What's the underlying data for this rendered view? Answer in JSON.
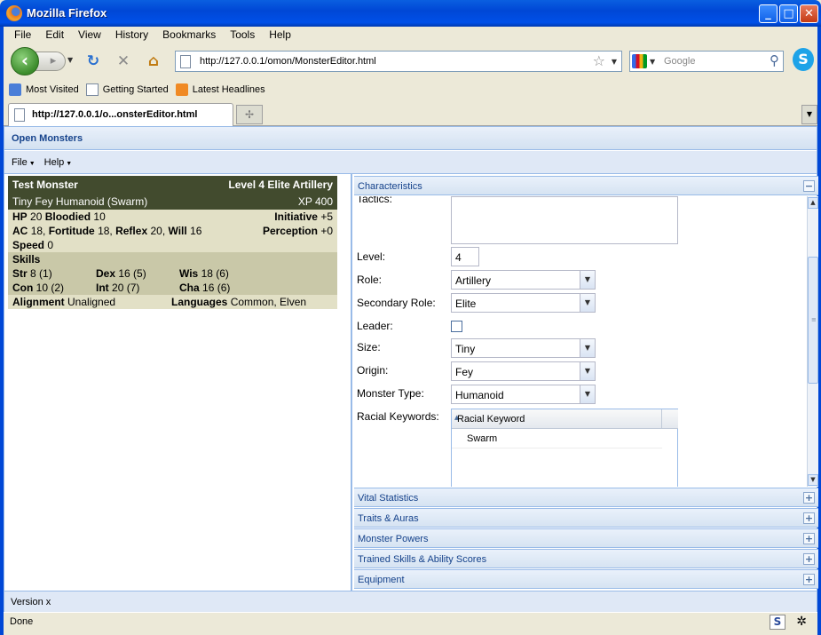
{
  "window": {
    "title": "Mozilla Firefox",
    "minimize": "_",
    "maximize": "□",
    "close": "✕"
  },
  "menubar": [
    "File",
    "Edit",
    "View",
    "History",
    "Bookmarks",
    "Tools",
    "Help"
  ],
  "nav": {
    "url": "http://127.0.0.1/omon/MonsterEditor.html",
    "search_placeholder": "Google"
  },
  "bookmarks": [
    "Most Visited",
    "Getting Started",
    "Latest Headlines"
  ],
  "tab": {
    "title": "http://127.0.0.1/o...onsterEditor.html"
  },
  "app": {
    "title": "Open Monsters",
    "menus": [
      "File",
      "Help"
    ],
    "footer": "Version x"
  },
  "statblock": {
    "name": "Test Monster",
    "role_line": "Level 4 Elite Artillery",
    "type_line": "Tiny Fey Humanoid (Swarm)",
    "xp": "XP 400",
    "hp_label": "HP",
    "hp": "20",
    "bloodied_label": "Bloodied",
    "bloodied": "10",
    "initiative_label": "Initiative",
    "initiative": "+5",
    "ac_label": "AC",
    "ac": "18,",
    "fort_label": "Fortitude",
    "fort": "18,",
    "ref_label": "Reflex",
    "ref": "20,",
    "will_label": "Will",
    "will": "16",
    "perception_label": "Perception",
    "perception": "+0",
    "speed_label": "Speed",
    "speed": "0",
    "skills_label": "Skills",
    "str_label": "Str",
    "str": "8 (1)",
    "dex_label": "Dex",
    "dex": "16 (5)",
    "wis_label": "Wis",
    "wis": "18 (6)",
    "con_label": "Con",
    "con": "10 (2)",
    "int_label": "Int",
    "int": "20 (7)",
    "cha_label": "Cha",
    "cha": "16 (6)",
    "alignment_label": "Alignment",
    "alignment": "Unaligned",
    "languages_label": "Languages",
    "languages": "Common, Elven"
  },
  "characteristics": {
    "header": "Characteristics",
    "tactics_label": "Tactics:",
    "level_label": "Level:",
    "level": "4",
    "role_label": "Role:",
    "role": "Artillery",
    "secondary_role_label": "Secondary Role:",
    "secondary_role": "Elite",
    "leader_label": "Leader:",
    "leader_checked": false,
    "size_label": "Size:",
    "size": "Tiny",
    "origin_label": "Origin:",
    "origin": "Fey",
    "monster_type_label": "Monster Type:",
    "monster_type": "Humanoid",
    "racial_keywords_label": "Racial Keywords:",
    "grid_column": "Racial Keyword",
    "racial_keywords": [
      "Swarm"
    ]
  },
  "sections": [
    "Vital Statistics",
    "Traits & Auras",
    "Monster Powers",
    "Trained Skills & Ability Scores",
    "Equipment"
  ],
  "status": {
    "text": "Done"
  }
}
